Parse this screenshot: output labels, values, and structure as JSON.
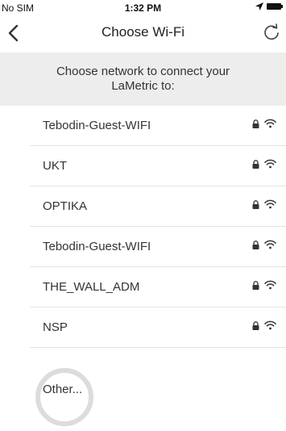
{
  "status_bar": {
    "carrier": "No SIM",
    "time": "1:32 PM"
  },
  "nav": {
    "title": "Choose Wi-Fi"
  },
  "instruction": "Choose network to connect your LaMetric to:",
  "networks": [
    {
      "name": "Tebodin-Guest-WIFI"
    },
    {
      "name": "UKT"
    },
    {
      "name": "OPTIKA"
    },
    {
      "name": "Tebodin-Guest-WIFI"
    },
    {
      "name": "THE_WALL_ADM"
    },
    {
      "name": "NSP"
    }
  ],
  "other_label": "Other...",
  "icons": {
    "back": "chevron-left-icon",
    "refresh": "refresh-icon",
    "lock": "lock-icon",
    "wifi": "wifi-icon"
  }
}
